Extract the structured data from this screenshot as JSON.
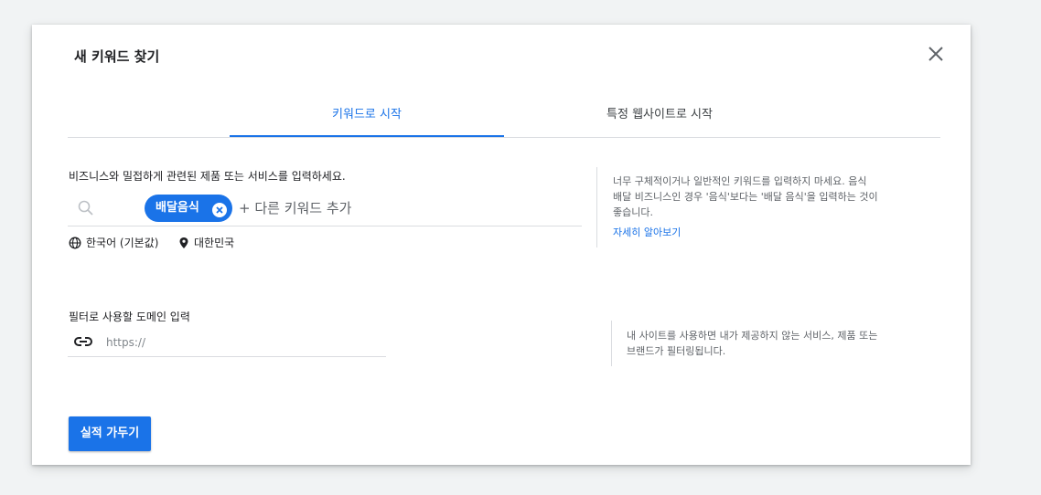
{
  "dialog": {
    "title": "새 키워드 찾기",
    "close_icon": "close-icon"
  },
  "tabs": [
    {
      "label": "키워드로 시작",
      "active": true
    },
    {
      "label": "특정 웹사이트로 시작",
      "active": false
    }
  ],
  "keywords_section": {
    "label": "비즈니스와 밀접하게 관련된 제품 또는 서비스를 입력하세요.",
    "chips": [
      "배달음식"
    ],
    "add_placeholder": "+ 다른 키워드 추가",
    "language": "한국어 (기본값)",
    "location": "대한민국",
    "help_text_line1": "너무 구체적이거나 일반적인 키워드를 입력하지 마세요. 음식",
    "help_text_line2": "배달 비즈니스인 경우 '음식'보다는 '배달 음식'을 입력하는 것이",
    "help_text_line3": "좋습니다.",
    "help_link": "자세히 알아보기"
  },
  "domain_section": {
    "label": "필터로 사용할 도메인 입력",
    "placeholder": "https://",
    "value": "",
    "help_text_line1": "내 사이트를 사용하면 내가 제공하지 않는 서비스, 제품 또는",
    "help_text_line2": "브랜드가 필터링됩니다."
  },
  "primary_button": "실적 가두기",
  "colors": {
    "accent": "#1a73e8",
    "text": "#202124",
    "muted": "#5f6368",
    "divider": "#dadce0"
  }
}
